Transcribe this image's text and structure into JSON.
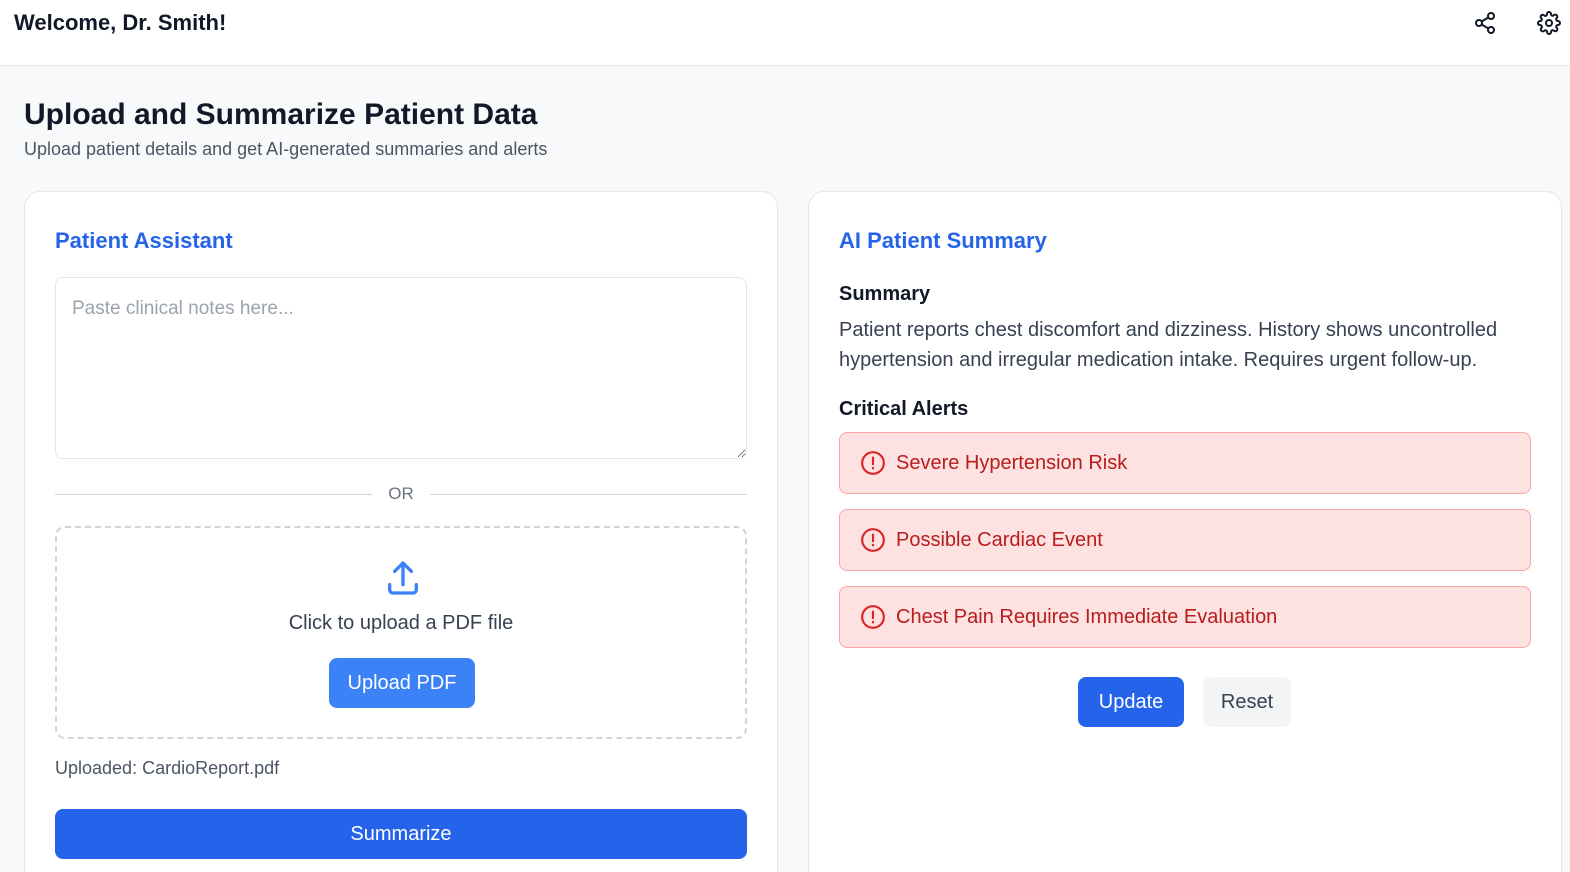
{
  "header": {
    "welcome": "Welcome, Dr. Smith!",
    "icons": [
      "share-icon",
      "gear-icon"
    ]
  },
  "page": {
    "title": "Upload and Summarize Patient Data",
    "subtitle": "Upload patient details and get AI-generated summaries and alerts"
  },
  "assistant": {
    "title": "Patient Assistant",
    "notes_placeholder": "Paste clinical notes here...",
    "notes_value": "",
    "or_label": "OR",
    "dropzone_text": "Click to upload a PDF file",
    "upload_button": "Upload PDF",
    "uploaded_file": "Uploaded: CardioReport.pdf",
    "summarize_button": "Summarize"
  },
  "summary_panel": {
    "title": "AI Patient Summary",
    "summary_label": "Summary",
    "summary_text": "Patient reports chest discomfort and dizziness. History shows uncontrolled hypertension and irregular medication intake. Requires urgent follow-up.",
    "alerts_label": "Critical Alerts",
    "alerts": [
      "Severe Hypertension Risk",
      "Possible Cardiac Event",
      "Chest Pain Requires Immediate Evaluation"
    ],
    "update_button": "Update",
    "reset_button": "Reset"
  },
  "colors": {
    "accent": "#2563eb",
    "upload_button": "#3b82f6",
    "alert_bg": "#fee2e2",
    "alert_border": "#fca5a5",
    "alert_text": "#b91c1c",
    "page_bg": "#f8f9fb"
  }
}
